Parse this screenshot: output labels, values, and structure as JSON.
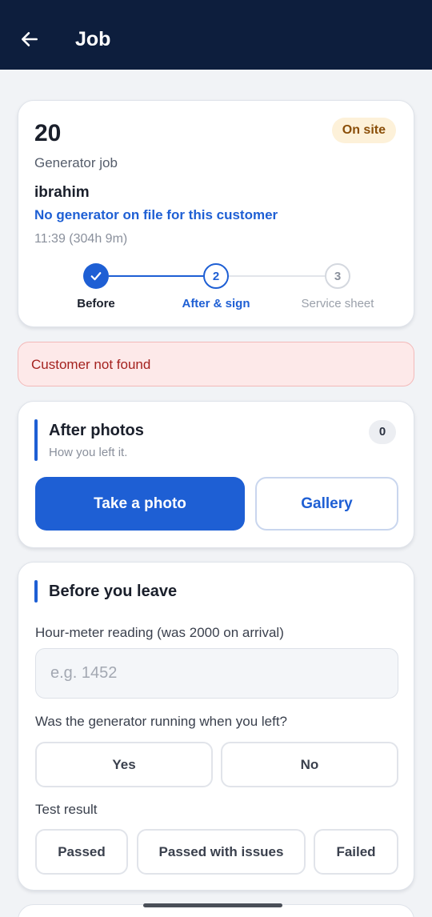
{
  "appbar": {
    "title": "Job",
    "back_icon": "arrow-left-icon"
  },
  "job": {
    "number": "20",
    "status": "On site",
    "type": "Generator job",
    "customer": "ibrahim",
    "generator_note": "No generator on file for this customer",
    "time": "11:39 (304h 9m)",
    "steps": [
      {
        "number": "✓",
        "label": "Before",
        "state": "done"
      },
      {
        "number": "2",
        "label": "After & sign",
        "state": "current"
      },
      {
        "number": "3",
        "label": "Service sheet",
        "state": "upcoming"
      }
    ]
  },
  "alert": {
    "text": "Customer not found"
  },
  "after_photos": {
    "title": "After photos",
    "subtitle": "How you left it.",
    "count": "0",
    "take_photo_label": "Take a photo",
    "gallery_label": "Gallery"
  },
  "before_leave": {
    "title": "Before you leave",
    "meter_label": "Hour-meter reading (was 2000 on arrival)",
    "meter_placeholder": "e.g. 1452",
    "meter_value": "",
    "running_label": "Was the generator running when you left?",
    "running_options": [
      "Yes",
      "No"
    ],
    "test_label": "Test result",
    "test_options": [
      "Passed",
      "Passed with issues",
      "Failed"
    ]
  },
  "colors": {
    "appbar": "#0d1e3d",
    "accent": "#1e5fd4",
    "status_badge_bg": "#fdf1d9",
    "status_badge_text": "#8a4e08",
    "alert_bg": "#fde9e9",
    "alert_text": "#a4221f"
  }
}
